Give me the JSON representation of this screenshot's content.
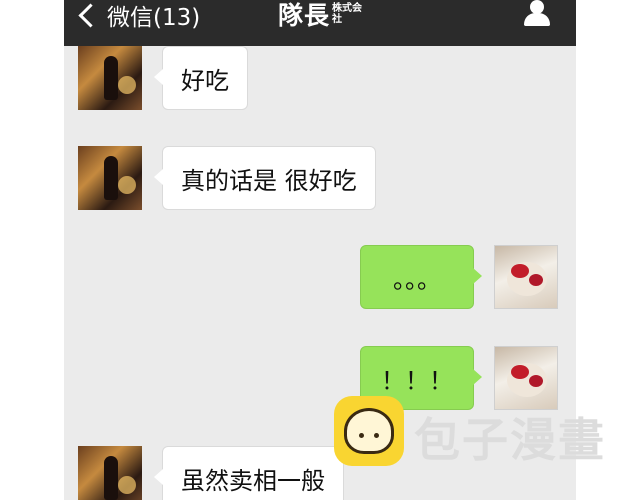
{
  "header": {
    "back_label": "微信(13)",
    "title": "隊長",
    "title_sub": "株式会社",
    "back_icon": "chevron-left-icon",
    "profile_icon": "person-icon"
  },
  "messages": [
    {
      "from": "friend",
      "text": "好吃"
    },
    {
      "from": "friend",
      "text": "真的话是 很好吃"
    },
    {
      "from": "me",
      "text": "。。。"
    },
    {
      "from": "me",
      "text": "！！！"
    },
    {
      "from": "friend",
      "text": "虽然卖相一般"
    }
  ],
  "watermark": {
    "text": "包子漫畫",
    "icon": "steamed-bun-icon"
  },
  "colors": {
    "topbar": "#2b2b2b",
    "chat_bg": "#ebebeb",
    "bubble_self": "#96e35a",
    "bubble_other": "#ffffff",
    "watermark_icon": "#f9d531"
  }
}
